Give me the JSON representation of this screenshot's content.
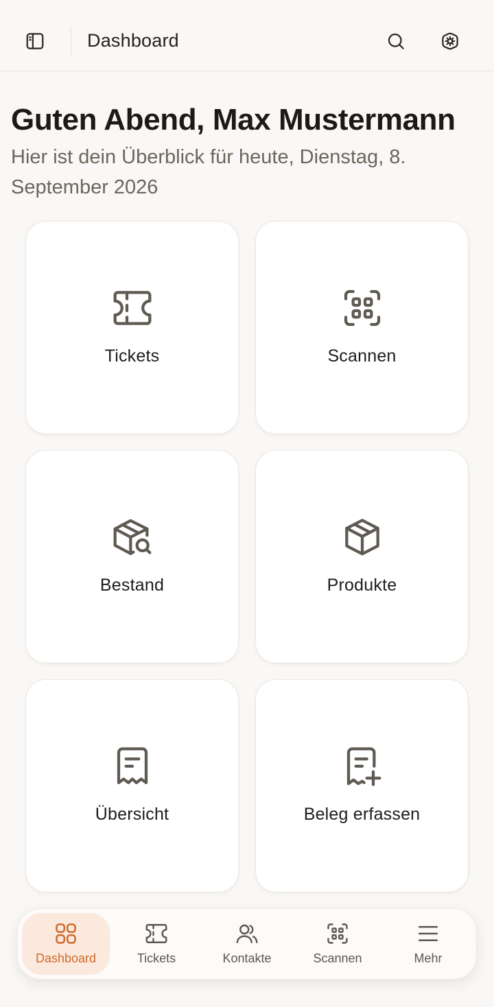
{
  "header": {
    "title": "Dashboard",
    "left_icon": "sidebar-toggle-icon",
    "right_icons": [
      "search-icon",
      "settings-icon"
    ]
  },
  "greeting": {
    "title": "Guten Abend, Max Mustermann",
    "subtitle": "Hier ist dein Überblick für heute, Dienstag, 8. September 2026"
  },
  "tiles": [
    {
      "label": "Tickets",
      "icon": "ticket-icon"
    },
    {
      "label": "Scannen",
      "icon": "scan-icon"
    },
    {
      "label": "Bestand",
      "icon": "package-search-icon"
    },
    {
      "label": "Produkte",
      "icon": "package-icon"
    },
    {
      "label": "Übersicht",
      "icon": "receipt-icon"
    },
    {
      "label": "Beleg erfassen",
      "icon": "receipt-add-icon"
    }
  ],
  "bottom_nav": {
    "active": "Dashboard",
    "items": [
      {
        "label": "Dashboard",
        "icon": "dashboard-grid-icon"
      },
      {
        "label": "Tickets",
        "icon": "ticket-icon"
      },
      {
        "label": "Kontakte",
        "icon": "contacts-icon"
      },
      {
        "label": "Scannen",
        "icon": "scan-icon"
      },
      {
        "label": "Mehr",
        "icon": "menu-icon"
      }
    ]
  },
  "colors": {
    "background": "#faf8f6",
    "accent": "#cf6a2a",
    "accent_bg": "#fbe9de",
    "icon": "#5f5a52"
  }
}
